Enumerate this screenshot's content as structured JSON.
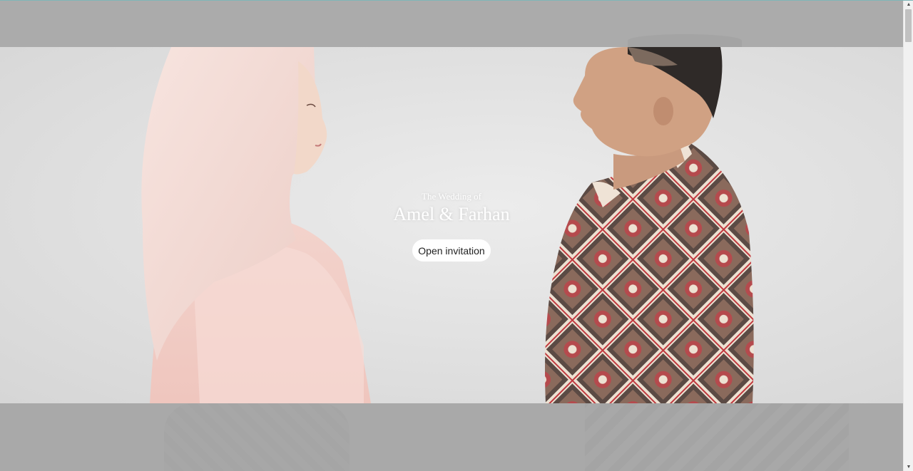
{
  "hero": {
    "subtitle": "The Wedding of",
    "names": "Amel & Farhan",
    "button_label": "Open invitation"
  },
  "colors": {
    "overlay_band": "#ababab",
    "hero_background": "#e6e6e6",
    "button_background": "#ffffff",
    "text_on_image": "#ffffff"
  },
  "icons": {
    "scroll_up": "chevron-up-icon",
    "scroll_down": "chevron-down-icon"
  }
}
